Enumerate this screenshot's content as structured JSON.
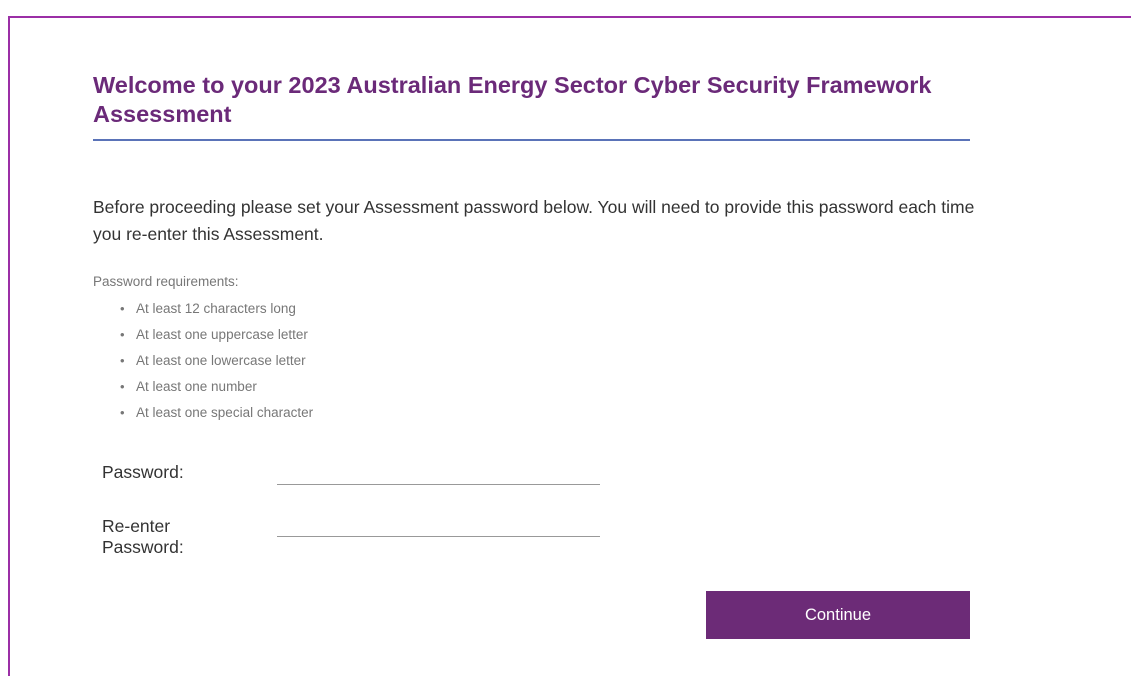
{
  "page": {
    "title": "Welcome to your 2023 Australian Energy Sector Cyber Security Framework Assessment",
    "intro": "Before proceeding please set your Assessment password below. You will need to provide this password each time you re-enter this Assessment."
  },
  "requirements": {
    "heading": "Password requirements:",
    "bullet_glyph": "•",
    "items": [
      "At least 12 characters long",
      "At least one uppercase letter",
      "At least one lowercase letter",
      "At least one number",
      "At least one special character"
    ]
  },
  "form": {
    "password_label": "Password:",
    "password_value": "",
    "reenter_label_line1": "Re-enter",
    "reenter_label_line2": "Password:",
    "reenter_value": "",
    "continue_label": "Continue"
  },
  "colors": {
    "accent": "#6c2b77",
    "title": "#6b2a79",
    "frame_border": "#9b2fa6",
    "rule": "#5a73b8"
  }
}
